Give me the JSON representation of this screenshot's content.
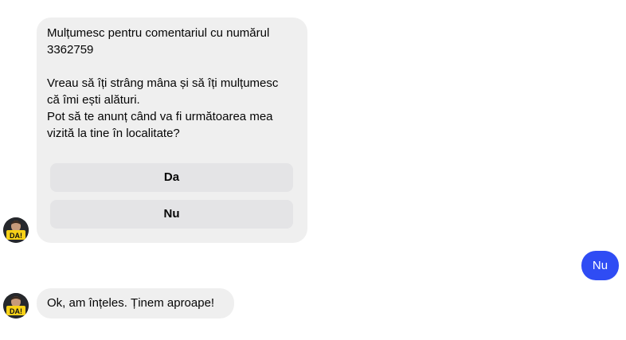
{
  "conversation": {
    "bot_message": {
      "text": "Mulțumesc pentru comentariul cu numărul\n3362759\n\nVreau să îți strâng mâna și să îți mulțumesc\ncă îmi ești alături.\nPot să te anunț când va fi următoarea mea\nvizită la tine în localitate?",
      "buttons": [
        {
          "label": "Da"
        },
        {
          "label": "Nu"
        }
      ]
    },
    "user_reply": {
      "text": "Nu"
    },
    "bot_reply": {
      "text": "Ok, am înțeles. Ținem aproape!"
    },
    "avatar": {
      "badge_text": "DA!",
      "icon": "profile-avatar"
    }
  },
  "colors": {
    "incoming_bubble": "#efefef",
    "outgoing_bubble": "#2f4cf4",
    "button_bg": "#e4e4e6",
    "avatar_badge": "#f7d117"
  }
}
